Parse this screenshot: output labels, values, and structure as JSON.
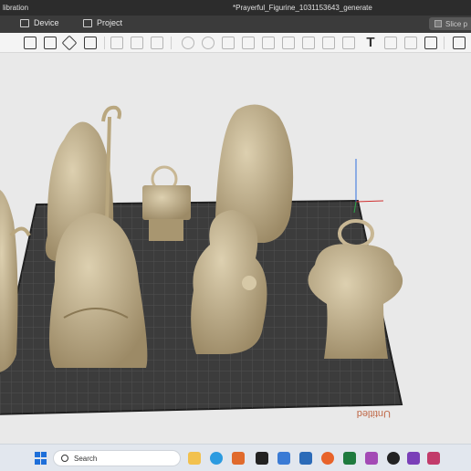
{
  "titlebar": {
    "left_text": "libration",
    "file_title": "*Prayerful_Figurine_1031153643_generate"
  },
  "tabs": [
    {
      "label": "Device",
      "icon": "monitor-icon"
    },
    {
      "label": "Project",
      "icon": "project-icon"
    }
  ],
  "slice_button": {
    "label": "Slice p"
  },
  "toolbar_icons": [
    "add-object-icon",
    "grid-icon",
    "orient-icon",
    "fit-view-icon",
    "move-icon",
    "rotate-icon",
    "scale-icon",
    "cut-icon",
    "arrange-icon",
    "split-icon",
    "paint-icon",
    "seam-icon",
    "text-icon",
    "support-icon",
    "measure-icon",
    "assembly-icon"
  ],
  "taskbar": {
    "search_placeholder": "Search",
    "apps": [
      "file-explorer-icon",
      "edge-icon",
      "office-icon",
      "terminal-icon",
      "bambu-icon",
      "firefox-icon",
      "excel-icon",
      "app-icon",
      "media-icon",
      "gallery-icon",
      "store-icon"
    ]
  },
  "colors": {
    "plate": "#3c3c3c",
    "figure": "#c8b794",
    "accent_green": "#2ea84a"
  }
}
